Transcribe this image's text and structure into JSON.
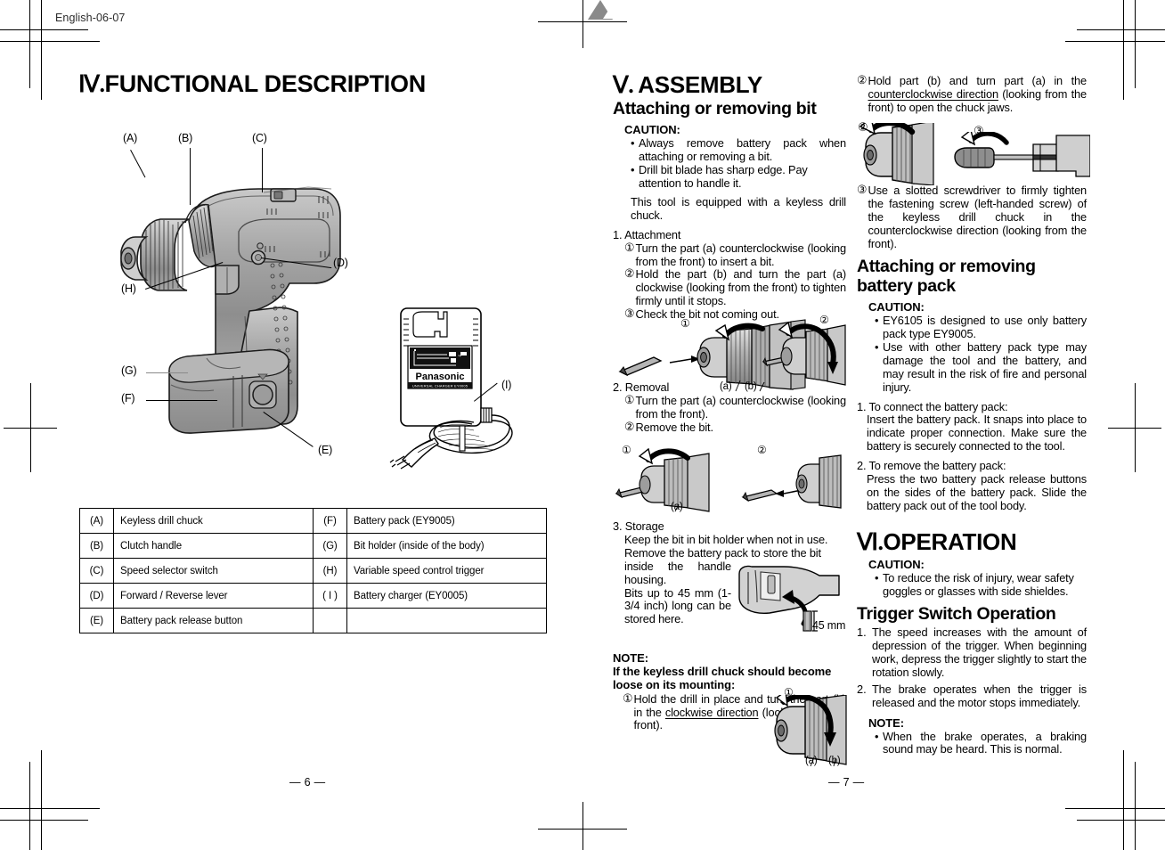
{
  "header": {
    "running_head": "English-06-07"
  },
  "left_page": {
    "number": "— 6 —",
    "section": {
      "numeral": "Ⅳ.",
      "title": "FUNCTIONAL DESCRIPTION"
    },
    "figure_callouts": [
      "(A)",
      "(B)",
      "(C)",
      "(D)",
      "(H)",
      "(G)",
      "(F)",
      "(E)",
      "(I)"
    ],
    "charger_brand": "Panasonic",
    "charger_label": "UNIVERSAL CHARGER   EY0005",
    "parts_table": [
      {
        "key": "(A)",
        "value": "Keyless drill chuck",
        "key2": "(F)",
        "value2": "Battery pack (EY9005)"
      },
      {
        "key": "(B)",
        "value": "Clutch handle",
        "key2": "(G)",
        "value2": "Bit holder (inside of the body)"
      },
      {
        "key": "(C)",
        "value": "Speed selector switch",
        "key2": "(H)",
        "value2": "Variable speed control trigger"
      },
      {
        "key": "(D)",
        "value": "Forward / Reverse lever",
        "key2": "( I )",
        "value2": "Battery charger (EY0005)"
      },
      {
        "key": "(E)",
        "value": "Battery pack release button",
        "key2": "",
        "value2": ""
      }
    ]
  },
  "right_page": {
    "number": "— 7 —",
    "assembly": {
      "numeral": "Ⅴ.",
      "title": "ASSEMBLY",
      "subtitle": "Attaching or removing bit",
      "caution_label": "CAUTION:",
      "caution_items": [
        "Always remove battery pack when attaching or removing a bit.",
        "Drill bit blade has sharp edge. Pay attention to handle it."
      ],
      "intro": "This tool is equipped with a keyless drill chuck.",
      "step1_label": "1. Attachment",
      "step1_items": [
        {
          "mark": "①",
          "text": "Turn the part (a) counterclockwise (looking from the front) to insert a bit."
        },
        {
          "mark": "②",
          "text": "Hold the part (b) and turn the part (a) clockwise (looking from the front) to tighten firmly until it stops."
        },
        {
          "mark": "③",
          "text": "Check the bit not coming out."
        }
      ],
      "fig1_marks": [
        "①",
        "②"
      ],
      "fig1_parts": [
        "(a)",
        "(b)"
      ],
      "step2_label": "2. Removal",
      "step2_items": [
        {
          "mark": "①",
          "text": "Turn the part (a) counterclockwise (looking from the front)."
        },
        {
          "mark": "②",
          "text": "Remove the bit."
        }
      ],
      "fig2_marks": [
        "①",
        "②"
      ],
      "fig2_parts": [
        "(a)"
      ],
      "step3_label": "3. Storage",
      "step3_text1": "Keep the bit in bit holder when not in use.",
      "step3_text2": "Remove the battery pack to store the bit",
      "step3_text3": "inside the handle housing.",
      "step3_text4": "Bits up to 45 mm (1-3/4 inch) long can be stored here.",
      "bit_length_label": "45 mm",
      "note_label": "NOTE:",
      "note_title": "If the keyless drill chuck should become loose on its mounting:",
      "note_items": [
        {
          "mark": "①",
          "pre": "Hold the drill in place and turn the part (b) in the ",
          "underlined": "clockwise direction",
          "post": " (looking from the front)."
        }
      ],
      "fig3_mark": "①",
      "fig3_parts": [
        "(a)",
        "(b)"
      ],
      "note_items_cont": [
        {
          "mark": "②",
          "pre": "Hold part (b) and turn part (a) in the ",
          "underlined": "counterclockwise direction",
          "post": " (looking from the front) to open the chuck jaws."
        },
        {
          "mark": "③",
          "pre": "Use a slotted screwdriver to firmly tighten the fastening screw (left-handed screw) of the keyless drill chuck in the counterclockwise direction (looking from the front).",
          "underlined": "",
          "post": ""
        }
      ],
      "fig4_marks": [
        "②",
        "③"
      ]
    },
    "battery": {
      "subtitle": "Attaching or removing battery pack",
      "caution_label": "CAUTION:",
      "caution_items": [
        "EY6105 is designed to use only battery pack type EY9005.",
        "Use with other battery pack type may damage the tool and the battery, and may result in the risk of fire and personal injury."
      ],
      "step1_label": "1. To connect the battery pack:",
      "step1_text": "Insert the battery pack. It snaps into place to indicate proper connection. Make sure the battery is securely connected to the tool.",
      "step2_label": "2. To remove the battery pack:",
      "step2_text": "Press the two battery pack release buttons on the sides of the battery pack. Slide the battery pack out of the tool body."
    },
    "operation": {
      "numeral": "Ⅵ.",
      "title": "OPERATION",
      "caution_label": "CAUTION:",
      "caution_items": [
        "To reduce the risk of injury, wear safety goggles or glasses with side shieldes."
      ],
      "subtitle": "Trigger Switch Operation",
      "items": [
        {
          "n": "1.",
          "text": "The speed increases with the amount of depression of the trigger. When beginning work, depress the trigger slightly to start the rotation slowly."
        },
        {
          "n": "2.",
          "text": "The brake operates when the trigger is released and the motor stops immediately."
        }
      ],
      "note_label": "NOTE:",
      "note_items": [
        "When the brake operates, a braking sound may be heard. This is normal."
      ]
    }
  }
}
